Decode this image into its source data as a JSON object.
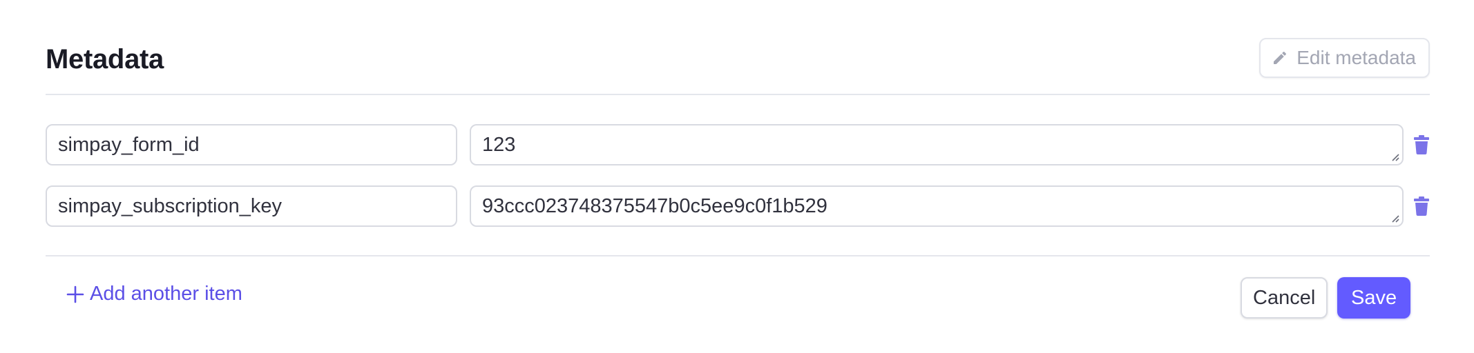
{
  "header": {
    "title": "Metadata",
    "edit_button_label": "Edit metadata",
    "edit_icon": "pencil-icon"
  },
  "rows": [
    {
      "key": "simpay_form_id",
      "value": "123"
    },
    {
      "key": "simpay_subscription_key",
      "value": "93ccc023748375547b0c5ee9c0f1b529"
    }
  ],
  "footer": {
    "add_item_label": "Add another item",
    "add_icon": "plus-icon",
    "cancel_label": "Cancel",
    "save_label": "Save"
  },
  "colors": {
    "accent": "#635bff",
    "link": "#5b4fe6",
    "trash_icon": "#7b73e8",
    "muted_text": "#a3a6b3",
    "border": "#d8dae1"
  },
  "icons": {
    "delete": "trash-icon",
    "resize": "resize-grip-icon"
  }
}
